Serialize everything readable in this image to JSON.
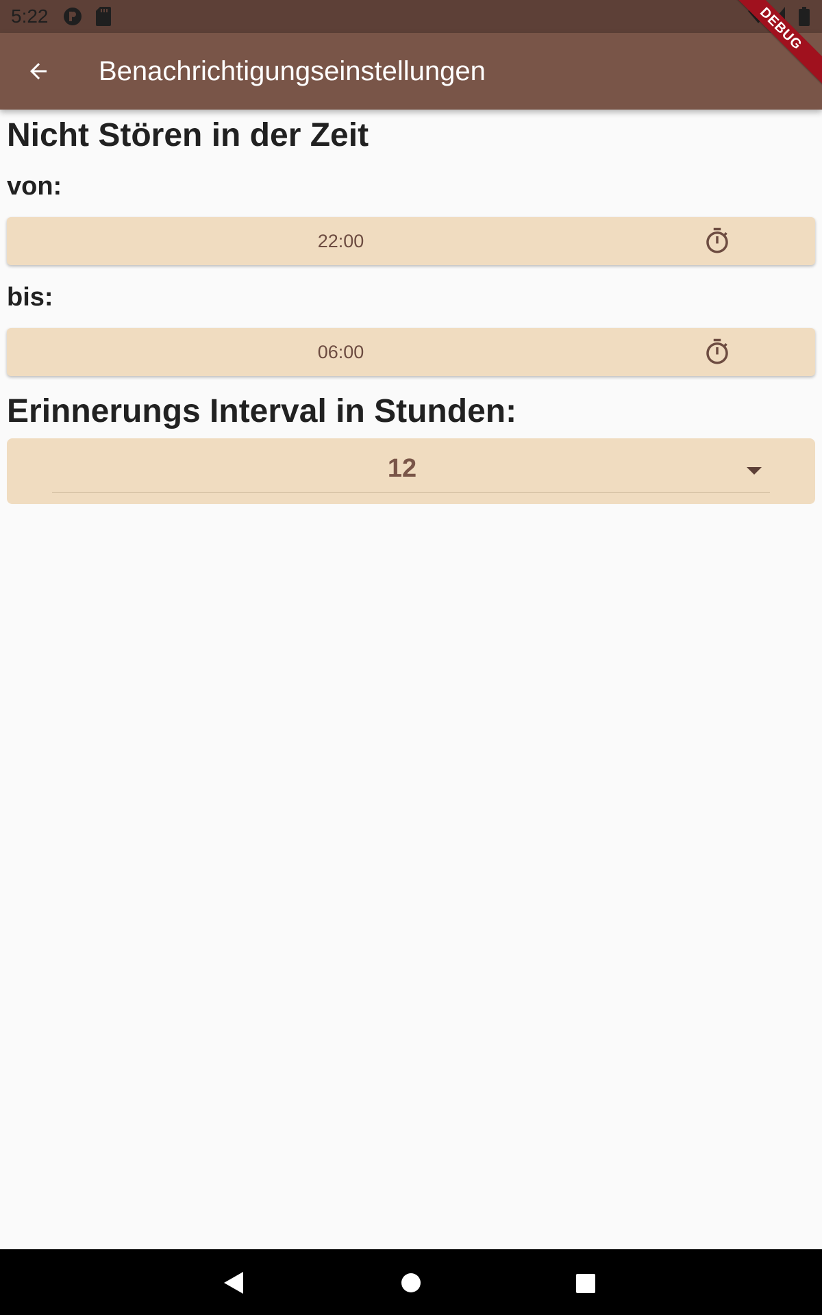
{
  "status_bar": {
    "time": "5:22",
    "left_icons": [
      "p-circle-icon",
      "sd-card-icon"
    ],
    "right_icons": [
      "wifi-icon",
      "signal-icon",
      "battery-icon"
    ]
  },
  "app_bar": {
    "title": "Benachrichtigungseinstellungen",
    "back_icon": "arrow-back-icon",
    "color": "#795548"
  },
  "debug_banner": "DEBUG",
  "do_not_disturb": {
    "title": "Nicht Stören in der Zeit",
    "from_label": "von:",
    "from_time": "22:00",
    "to_label": "bis:",
    "to_time": "06:00",
    "icon": "timer-icon"
  },
  "reminder_interval": {
    "title": "Erinnerungs Interval in Stunden:",
    "selected_value": "12",
    "icon": "arrow-drop-down-icon"
  },
  "nav_bar": {
    "icons": [
      "nav-back-icon",
      "nav-home-icon",
      "nav-recents-icon"
    ]
  },
  "colors": {
    "primary": "#795548",
    "primary_dark": "#5d4037",
    "button_fill": "#f0dcc0",
    "button_text": "#6d4c41",
    "background": "#fafafa"
  }
}
